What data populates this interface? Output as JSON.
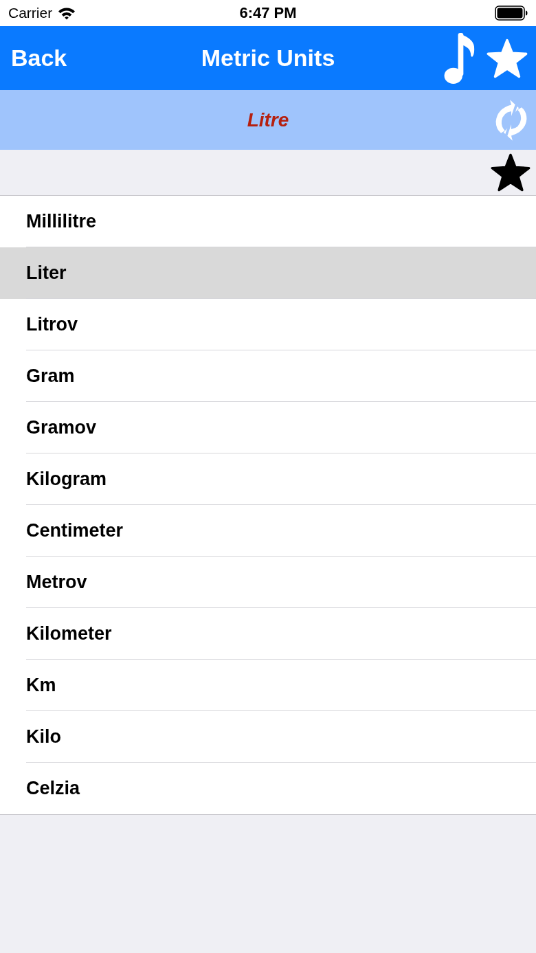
{
  "status_bar": {
    "carrier": "Carrier",
    "time": "6:47 PM"
  },
  "nav_bar": {
    "back": "Back",
    "title": "Metric Units"
  },
  "header": {
    "title": "Litre"
  },
  "units": [
    {
      "name": "Millilitre",
      "selected": false
    },
    {
      "name": "Liter",
      "selected": true
    },
    {
      "name": "Litrov",
      "selected": false
    },
    {
      "name": "Gram",
      "selected": false
    },
    {
      "name": "Gramov",
      "selected": false
    },
    {
      "name": "Kilogram",
      "selected": false
    },
    {
      "name": "Centimeter",
      "selected": false
    },
    {
      "name": "Metrov",
      "selected": false
    },
    {
      "name": "Kilometer",
      "selected": false
    },
    {
      "name": "Km",
      "selected": false
    },
    {
      "name": "Kilo",
      "selected": false
    },
    {
      "name": "Celzia",
      "selected": false
    }
  ]
}
